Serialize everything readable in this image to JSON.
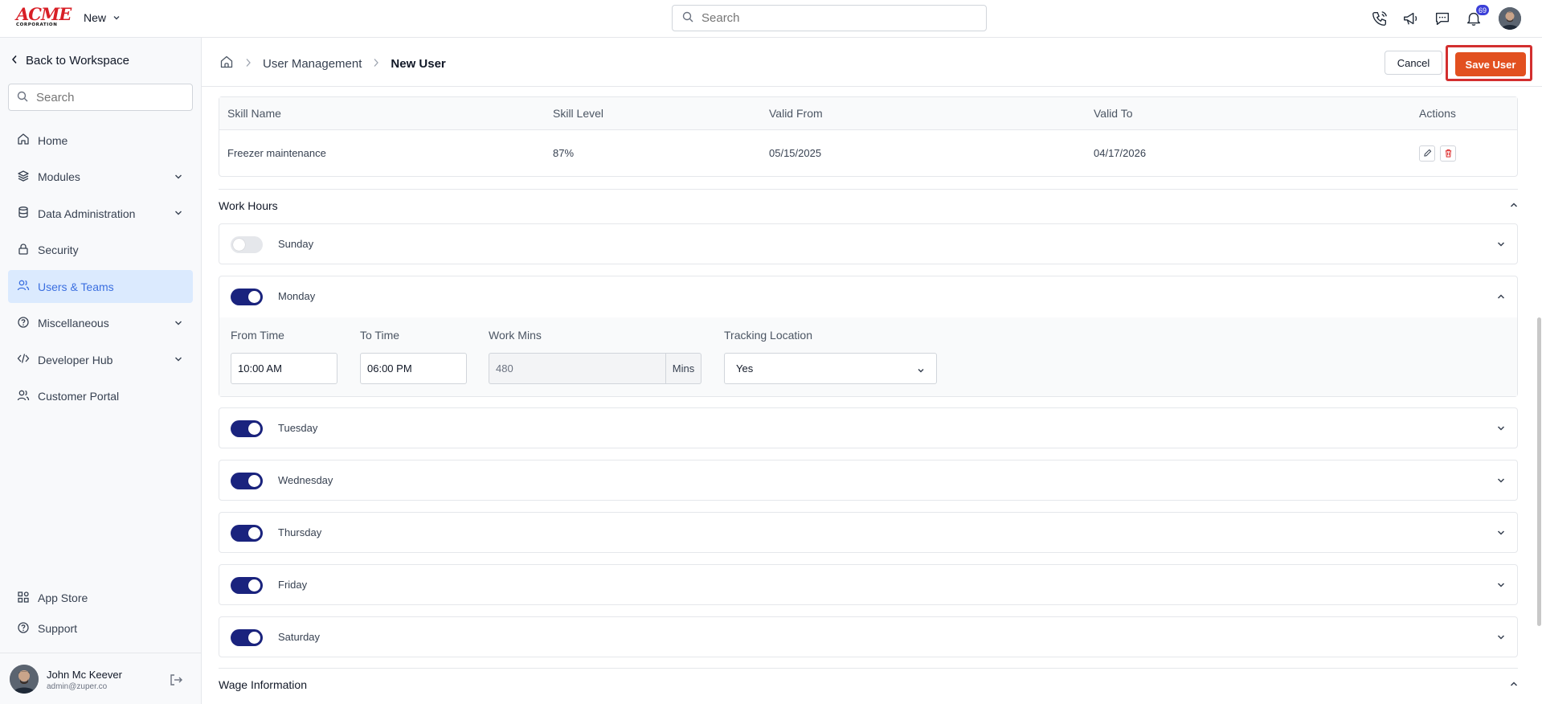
{
  "app": {
    "logo_main": "ACME",
    "logo_sub": "CORPORATION",
    "new_menu_label": "New",
    "search_placeholder": "Search",
    "notification_count": "69"
  },
  "sidebar": {
    "back_label": "Back to Workspace",
    "search_placeholder": "Search",
    "items": [
      {
        "label": "Home",
        "icon": "home-icon"
      },
      {
        "label": "Modules",
        "icon": "layers-icon",
        "expandable": true
      },
      {
        "label": "Data Administration",
        "icon": "database-icon",
        "expandable": true
      },
      {
        "label": "Security",
        "icon": "lock-icon"
      },
      {
        "label": "Users & Teams",
        "icon": "users-icon",
        "active": true
      },
      {
        "label": "Miscellaneous",
        "icon": "help-circle-icon",
        "expandable": true
      },
      {
        "label": "Developer Hub",
        "icon": "code-icon",
        "expandable": true
      },
      {
        "label": "Customer Portal",
        "icon": "users-icon"
      }
    ],
    "bottom_items": [
      {
        "label": "App Store",
        "icon": "grid-icon"
      },
      {
        "label": "Support",
        "icon": "help-circle-icon"
      }
    ],
    "user": {
      "name": "John Mc Keever",
      "email": "admin@zuper.co"
    }
  },
  "header": {
    "breadcrumb": [
      "User Management",
      "New User"
    ],
    "cancel_label": "Cancel",
    "save_label": "Save User"
  },
  "skills": {
    "columns": [
      "Skill Name",
      "Skill Level",
      "Valid From",
      "Valid To",
      "Actions"
    ],
    "rows": [
      {
        "name": "Freezer maintenance",
        "level": "87%",
        "valid_from": "05/15/2025",
        "valid_to": "04/17/2026"
      }
    ]
  },
  "work_hours": {
    "title": "Work Hours",
    "days": [
      {
        "name": "Sunday",
        "enabled": false,
        "expanded": false
      },
      {
        "name": "Monday",
        "enabled": true,
        "expanded": true
      },
      {
        "name": "Tuesday",
        "enabled": true,
        "expanded": false
      },
      {
        "name": "Wednesday",
        "enabled": true,
        "expanded": false
      },
      {
        "name": "Thursday",
        "enabled": true,
        "expanded": false
      },
      {
        "name": "Friday",
        "enabled": true,
        "expanded": false
      },
      {
        "name": "Saturday",
        "enabled": true,
        "expanded": false
      }
    ],
    "monday_detail": {
      "from_label": "From Time",
      "from_value": "10:00 AM",
      "to_label": "To Time",
      "to_value": "06:00 PM",
      "mins_label": "Work Mins",
      "mins_value": "480",
      "mins_unit": "Mins",
      "tracking_label": "Tracking Location",
      "tracking_value": "Yes"
    }
  },
  "wage": {
    "title": "Wage Information"
  },
  "colors": {
    "accent": "#e2501f",
    "toggle_on": "#1a237e",
    "active_nav_bg": "#dbeafe",
    "active_nav_text": "#3b6fe0",
    "highlight_border": "#d32f2f"
  }
}
